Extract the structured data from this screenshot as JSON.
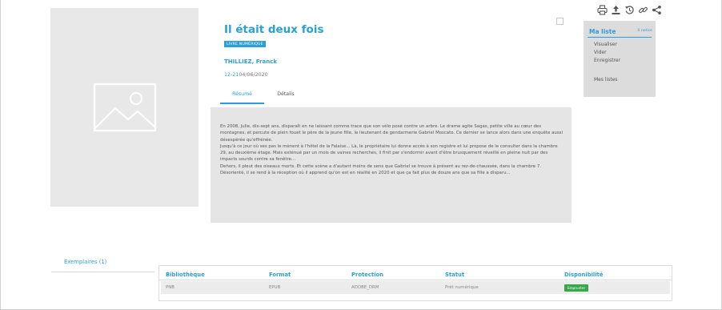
{
  "record": {
    "title": "Il était deux fois",
    "badge": "LIVRE NUMÉRIQUE",
    "author": "THILLIEZ, Franck",
    "date_prefix": "12-21",
    "date": "04/06/2020"
  },
  "tabs": [
    {
      "label": "Résumé",
      "active": true
    },
    {
      "label": "Détails",
      "active": false
    }
  ],
  "toolbar": {
    "icons": [
      "print-icon",
      "upload-icon",
      "history-icon",
      "link-icon",
      "share-icon"
    ]
  },
  "my_list": {
    "title": "Ma liste",
    "count": "0 notice",
    "links": [
      "Visualiser",
      "Vider",
      "Enregistrer"
    ],
    "my_lists": "Mes listes"
  },
  "summary": {
    "paragraphs": [
      "En 2008, Julie, dix-sept ans, disparaît en ne laissant comme trace que son vélo posé contre un arbre. Le drame agite Sagas, petite ville au cœur des montagnes, et percute de plein fouet le père de la jeune fille, le lieutenant de gendarmerie Gabriel Moscato. Ce dernier se lance alors dans une enquête aussi désespérée qu'effrénée.",
      "Jusqu'à ce jour où ses pas le mènent à l'hôtel de la Falaise... Là, le propriétaire lui donne accès à son registre et lui propose de le consulter dans la chambre 29, au deuxième étage. Mais exténué par un mois de vaines recherches, il finit par s'endormir avant d'être brusquement réveillé en pleine nuit par des impacts sourds contre sa fenêtre...",
      "Dehors, il pleut des oiseaux morts. Et cette scène a d'autant moins de sens que Gabriel se trouve à présent au rez-de-chaussée, dans la chambre 7. Désorienté, il se rend à la réception où il apprend qu'on est en réalité en 2020 et que ça fait plus de douze ans que sa fille a disparu..."
    ]
  },
  "copies": {
    "tab_label": "Exemplaires (1)",
    "headers": [
      "Bibliothèque",
      "Format",
      "Protection",
      "Statut",
      "Disponibilité"
    ],
    "rows": [
      {
        "library": "PNB",
        "format": "EPUB",
        "protection": "ADOBE_DRM",
        "status": "Prêt numérique",
        "action": "Emprunter"
      }
    ]
  },
  "colors": {
    "accent": "#2a9fd8",
    "panel": "#e5e5e5",
    "sidebar": "#dcdcdc",
    "success": "#36a84b"
  }
}
